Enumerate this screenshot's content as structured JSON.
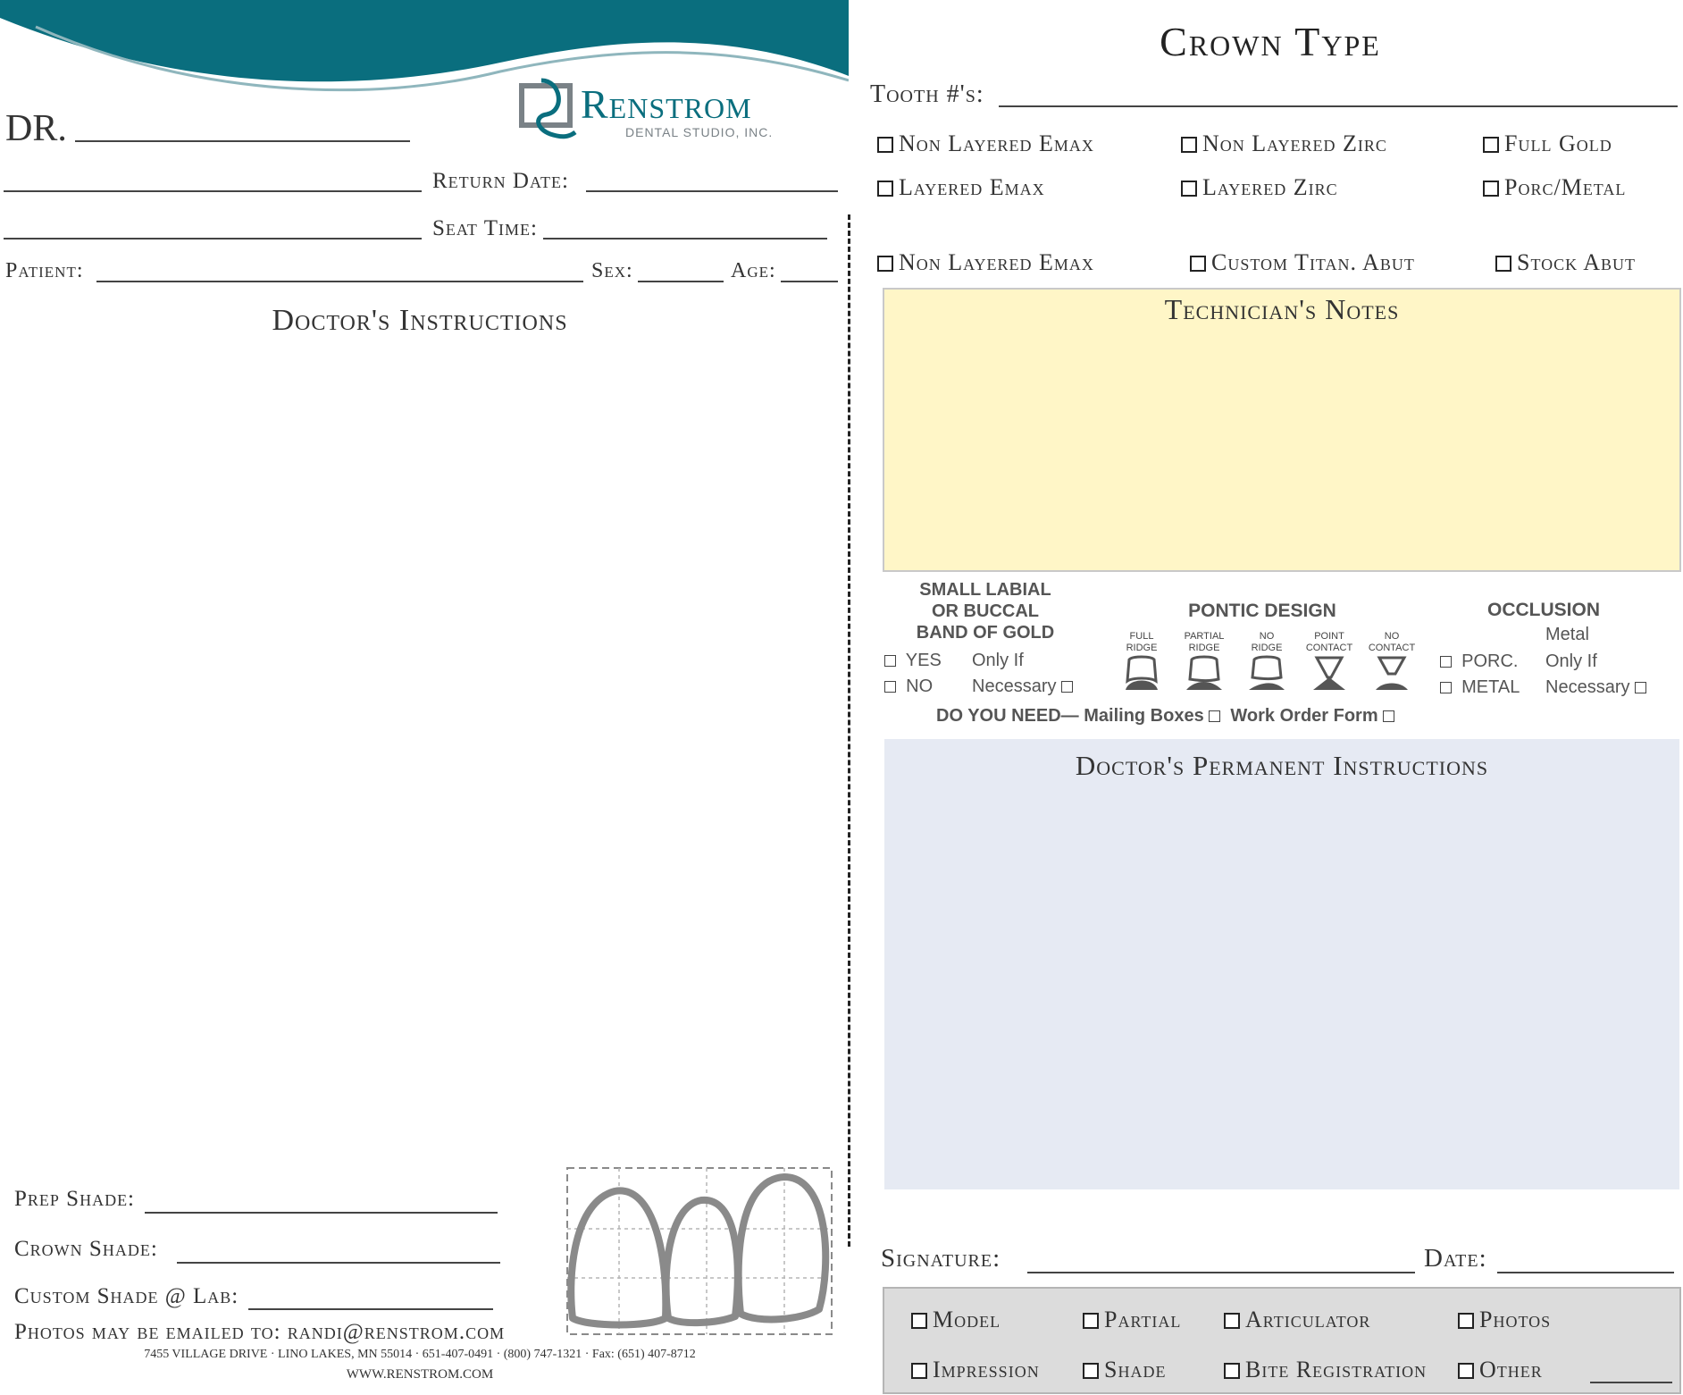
{
  "colors": {
    "teal": "#0a6e7e",
    "notes_bg": "#fff6c7",
    "perm_bg": "#e6eaf3",
    "footer_bg": "#dcdcdc"
  },
  "brand": {
    "name": "Renstrom",
    "sub": "DENTAL STUDIO, INC."
  },
  "left": {
    "dr_label": "DR.",
    "return_label": "Return Date:",
    "seat_label": "Seat Time:",
    "patient_label": "Patient:",
    "sex_label": "Sex:",
    "age_label": "Age:",
    "instructions_title": "Doctor's Instructions",
    "prep_shade": "Prep Shade:",
    "crown_shade": "Crown Shade:",
    "custom_shade": "Custom Shade @ Lab:",
    "photos": "Photos may be emailed to: randi@renstrom.com",
    "address": "7455 VILLAGE DRIVE · LINO LAKES, MN 55014 · 651-407-0491 · (800) 747-1321 · Fax: (651) 407-8712",
    "website": "WWW.RENSTROM.COM"
  },
  "right": {
    "crown_title": "Crown Type",
    "tooth_label": "Tooth #'s:",
    "options_row1": [
      "Non Layered Emax",
      "Non Layered Zirc",
      "Full Gold"
    ],
    "options_row2": [
      "Layered Emax",
      "Layered Zirc",
      "Porc/Metal"
    ],
    "options_row3": [
      "Non Layered Emax",
      "Custom Titan. Abut",
      "Stock Abut"
    ],
    "tech_notes_title": "Technician's Notes",
    "band": {
      "title_1": "SMALL LABIAL",
      "title_2": "OR BUCCAL",
      "title_3": "BAND OF GOLD",
      "yes": "YES",
      "no": "NO",
      "only_if": "Only If",
      "necessary": "Necessary"
    },
    "pontic": {
      "title": "PONTIC DESIGN",
      "items": [
        {
          "l1": "FULL",
          "l2": "RIDGE"
        },
        {
          "l1": "PARTIAL",
          "l2": "RIDGE"
        },
        {
          "l1": "NO",
          "l2": "RIDGE"
        },
        {
          "l1": "POINT",
          "l2": "CONTACT"
        },
        {
          "l1": "NO",
          "l2": "CONTACT"
        }
      ]
    },
    "occlusion": {
      "title": "OCCLUSION",
      "porc": "PORC.",
      "metal": "METAL",
      "metal_hdr": "Metal",
      "only_if": "Only If",
      "necessary": "Necessary"
    },
    "need": {
      "label": "DO YOU NEED—",
      "mailing": "Mailing Boxes",
      "work_order": "Work Order Form"
    },
    "perm_title": "Doctor's Permanent Instructions",
    "signature_label": "Signature:",
    "date_label": "Date:",
    "footer_row1": [
      "Model",
      "Partial",
      "Articulator",
      "Photos"
    ],
    "footer_row2": [
      "Impression",
      "Shade",
      "Bite Registration",
      "Other"
    ]
  }
}
